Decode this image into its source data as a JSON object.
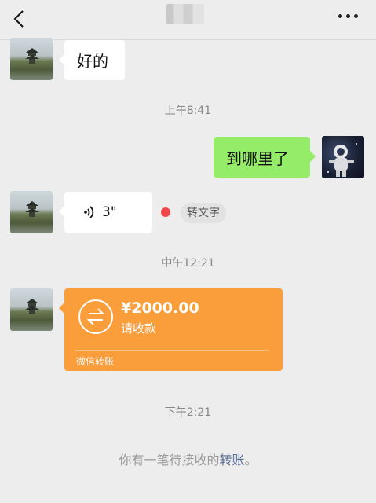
{
  "header": {
    "back_icon": "chevron-left-icon",
    "more_icon": "more-dots-icon"
  },
  "messages": {
    "msg1_text": "好的",
    "time1": "上午8:41",
    "msg2_text": "到哪里了",
    "voice_icon": "voice-wave-icon",
    "voice_duration": "3\"",
    "voice_to_text_label": "转文字",
    "time2": "中午12:21",
    "time3": "下午2:21"
  },
  "transfer": {
    "icon": "transfer-arrows-icon",
    "amount": "¥2000.00",
    "status": "请收款",
    "footer": "微信转账"
  },
  "notice": {
    "prefix": "你有一笔待接收的",
    "link": "转账",
    "suffix": "。"
  },
  "colors": {
    "background": "#ededed",
    "self_bubble": "#95ec69",
    "friend_bubble": "#ffffff",
    "transfer_card": "#fa9d3b",
    "unread_dot": "#f04848",
    "link": "#576b95"
  }
}
